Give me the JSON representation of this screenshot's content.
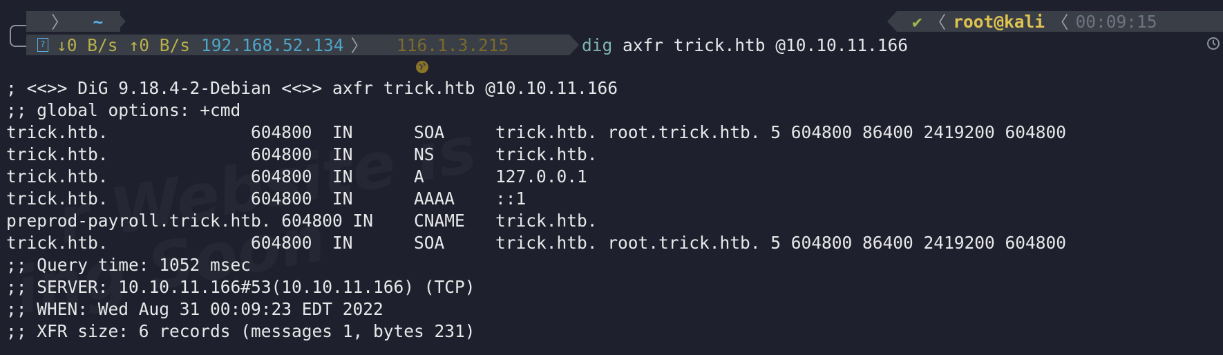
{
  "prompt": {
    "top_left": {
      "os_icon": "linux-tux-icon",
      "home_icon": "home-icon",
      "path": "~"
    },
    "net": {
      "iface_icon": "network-icon",
      "down": "↓0 B/s",
      "up": "↑0 B/s",
      "local_ip": "192.168.52.134",
      "public_icon": "globe-icon",
      "public_ip": "116.1.3.215"
    },
    "right": {
      "status": "✔",
      "user": "root@kali",
      "time": "00:09:15",
      "clock_icon": "clock-icon"
    },
    "command": {
      "program": "dig",
      "args": " axfr trick.htb @10.10.11.166"
    }
  },
  "output": [
    "",
    "; <<>> DiG 9.18.4-2-Debian <<>> axfr trick.htb @10.10.11.166",
    ";; global options: +cmd",
    "trick.htb.              604800  IN      SOA     trick.htb. root.trick.htb. 5 604800 86400 2419200 604800",
    "trick.htb.              604800  IN      NS      trick.htb.",
    "trick.htb.              604800  IN      A       127.0.0.1",
    "trick.htb.              604800  IN      AAAA    ::1",
    "preprod-payroll.trick.htb. 604800 IN    CNAME   trick.htb.",
    "trick.htb.              604800  IN      SOA     trick.htb. root.trick.htb. 5 604800 86400 2419200 604800",
    ";; Query time: 1052 msec",
    ";; SERVER: 10.10.11.166#53(10.10.11.166) (TCP)",
    ";; WHEN: Wed Aug 31 00:09:23 EDT 2022",
    ";; XFR size: 6 records (messages 1, bytes 231)"
  ],
  "colors": {
    "background": "#1e212d",
    "prompt_bar": "#3a3e47",
    "home_blue": "#5ab0e6",
    "net_green": "#b9b14a",
    "local_ip": "#4ea6c8",
    "public_ip": "#7a6a2c",
    "user_yellow": "#e0c44f",
    "time_gray": "#6b7580",
    "cmd_program": "#7fb4b0"
  }
}
